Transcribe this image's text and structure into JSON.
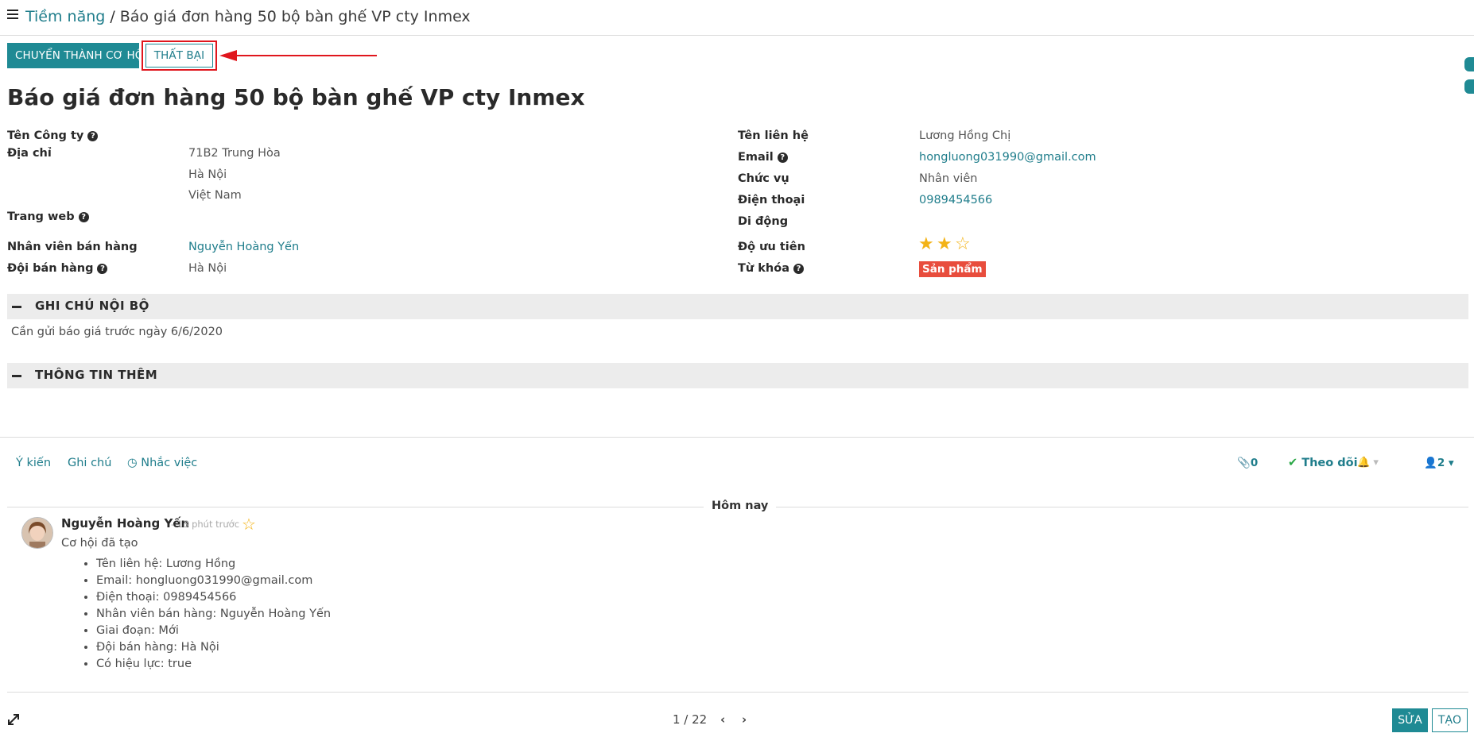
{
  "breadcrumb": {
    "parent": "Tiềm năng",
    "separator": "/",
    "current": "Báo giá đơn hàng 50 bộ bàn ghế VP cty Inmex"
  },
  "actions": {
    "convert": "CHUYỂN THÀNH CƠ HỘI",
    "lost": "THẤT BẠI"
  },
  "record": {
    "title": "Báo giá đơn hàng 50 bộ bàn ghế VP cty Inmex"
  },
  "left_fields": {
    "company_label": "Tên Công ty",
    "address_label": "Địa chỉ",
    "address_street": "71B2 Trung Hòa",
    "address_city": "Hà Nội",
    "address_country": "Việt Nam",
    "website_label": "Trang web",
    "salesperson_label": "Nhân viên bán hàng",
    "salesperson": "Nguyễn Hoàng Yến",
    "team_label": "Đội bán hàng",
    "team": "Hà Nội"
  },
  "right_fields": {
    "contact_label": "Tên liên hệ",
    "contact": "Lương Hồng Chị",
    "email_label": "Email",
    "email": "hongluong031990@gmail.com",
    "job_label": "Chức vụ",
    "job": "Nhân viên",
    "phone_label": "Điện thoại",
    "phone": "0989454566",
    "mobile_label": "Di động",
    "priority_label": "Độ ưu tiên",
    "priority_value": 2,
    "priority_max": 3,
    "tags_label": "Từ khóa",
    "tag": "Sản phẩm"
  },
  "sections": {
    "internal_notes": "GHI CHÚ NỘI BỘ",
    "internal_notes_text": "Cần gửi báo giá trước ngày 6/6/2020",
    "extra_info": "THÔNG TIN THÊM"
  },
  "chatter": {
    "send_message": "Ý kiến",
    "log_note": "Ghi chú",
    "schedule_activity": "Nhắc việc",
    "attachments_count": "0",
    "follow": "Theo dõi",
    "followers_count": "2",
    "today": "Hôm nay",
    "message": {
      "author": "Nguyễn Hoàng Yến",
      "time": "- 13 phút trước",
      "body": "Cơ hội đã tạo",
      "items": [
        "Tên liên hệ: Lương Hồng",
        "Email: hongluong031990@gmail.com",
        "Điện thoại: 0989454566",
        "Nhân viên bán hàng: Nguyễn Hoàng Yến",
        "Giai đoạn: Mới",
        "Đội bán hàng: Hà Nội",
        "Có hiệu lực: true"
      ]
    }
  },
  "pager": {
    "text": "1 / 22"
  },
  "bottom": {
    "edit": "SỬA",
    "create": "TẠO"
  },
  "colors": {
    "accent": "#1f8a94",
    "highlight": "#e0161d",
    "tag": "#e84d3d",
    "star": "#f3b317"
  }
}
